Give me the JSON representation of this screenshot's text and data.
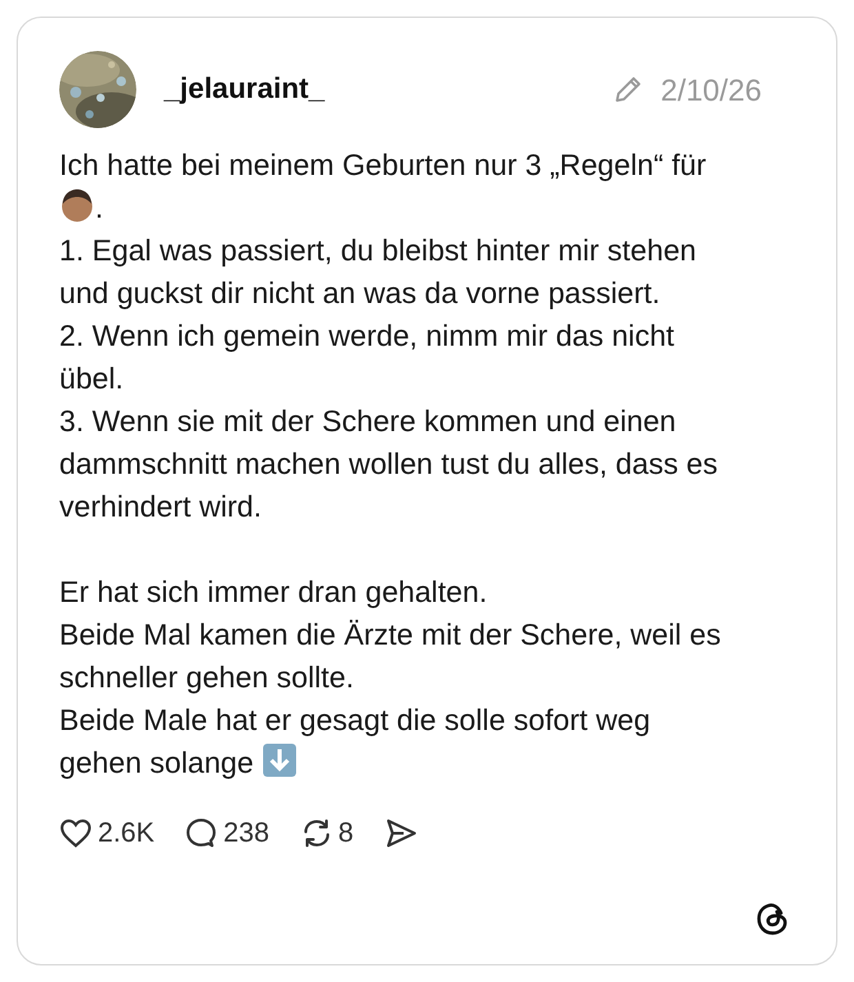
{
  "post": {
    "username": "_jelauraint_",
    "date": "2/10/26",
    "edited": true,
    "paragraphs": [
      {
        "lines": [
          {
            "kind": "plain",
            "text": "Ich hatte bei meinem Geburten nur 3 „Regeln“ für"
          },
          {
            "kind": "face",
            "text": "."
          },
          {
            "kind": "plain",
            "text": "1. Egal was passiert, du bleibst hinter mir stehen"
          },
          {
            "kind": "plain",
            "text": "und guckst dir nicht an was da vorne passiert."
          },
          {
            "kind": "plain",
            "text": "2. Wenn ich gemein werde, nimm mir das nicht"
          },
          {
            "kind": "plain",
            "text": "übel."
          },
          {
            "kind": "plain",
            "text": "3. Wenn sie mit der Schere kommen und einen"
          },
          {
            "kind": "plain",
            "text": "dammschnitt machen wollen tust du alles, dass es"
          },
          {
            "kind": "plain",
            "text": "verhindert wird."
          }
        ]
      },
      {
        "lines": [
          {
            "kind": "plain",
            "text": "Er hat sich immer dran gehalten."
          },
          {
            "kind": "plain",
            "text": "Beide Mal kamen die Ärzte mit der Schere, weil es"
          },
          {
            "kind": "plain",
            "text": "schneller gehen sollte."
          },
          {
            "kind": "plain",
            "text": "Beide Male hat er gesagt die solle sofort weg"
          },
          {
            "kind": "arrow",
            "text": "gehen solange"
          }
        ]
      }
    ],
    "actions": [
      {
        "kind": "like",
        "count": "2.6K"
      },
      {
        "kind": "reply",
        "count": "238"
      },
      {
        "kind": "repost",
        "count": "8"
      },
      {
        "kind": "share"
      }
    ]
  }
}
